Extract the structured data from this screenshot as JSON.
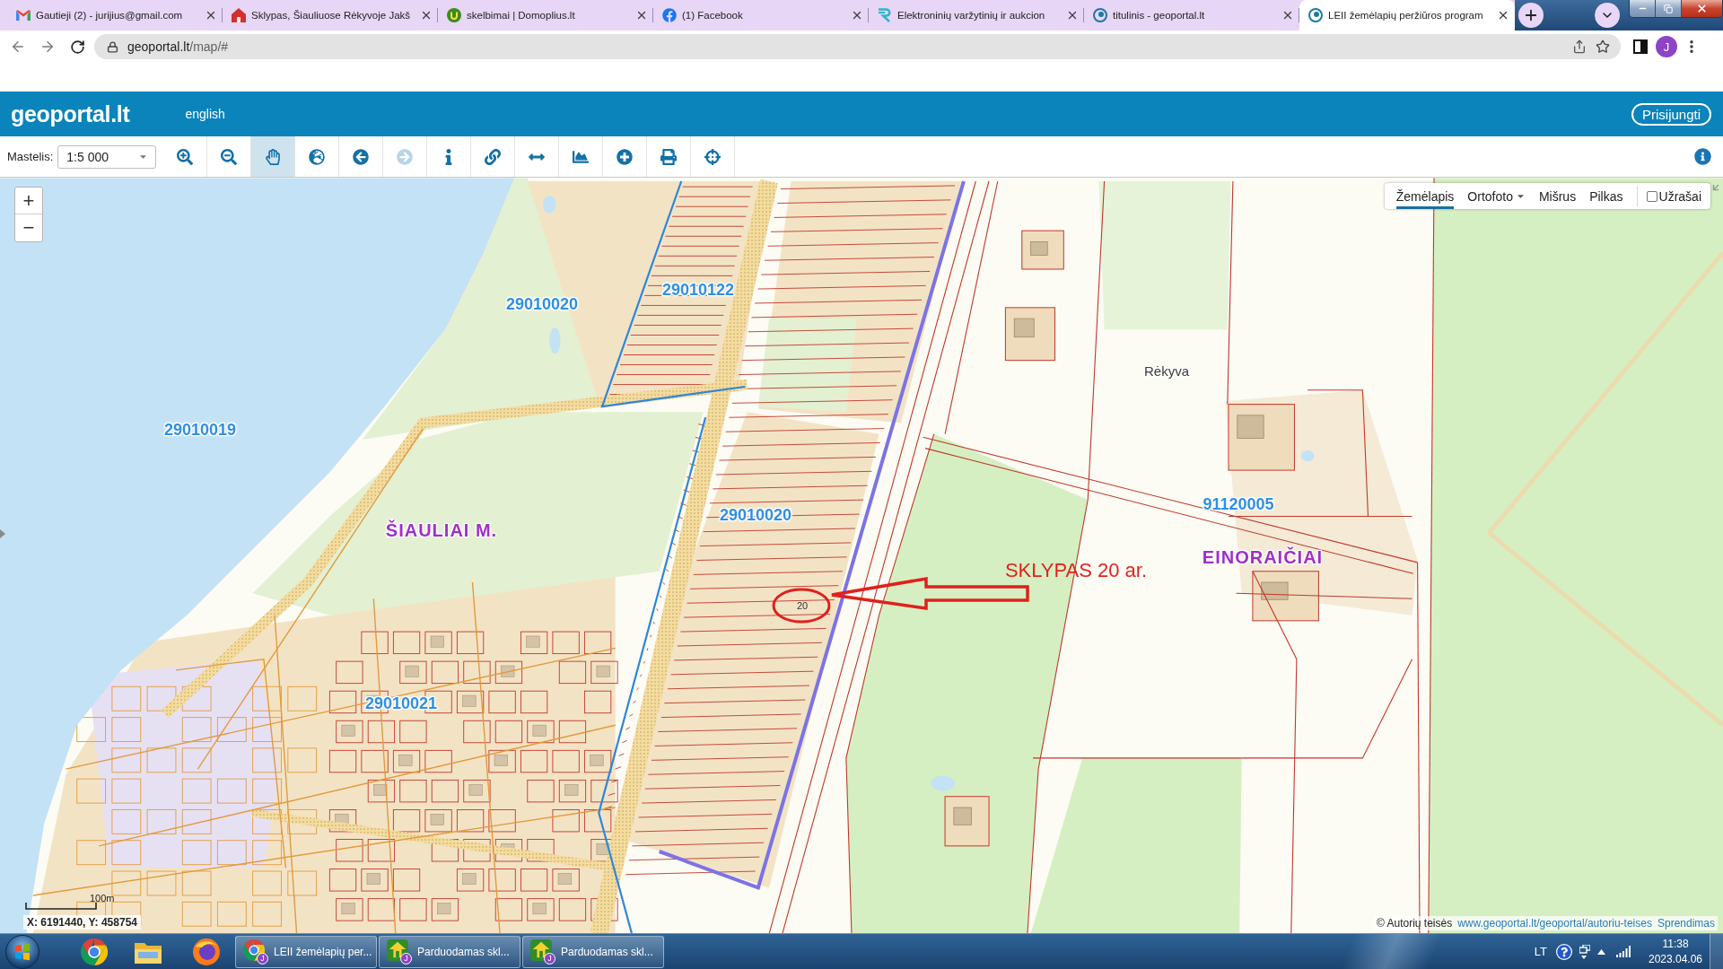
{
  "browser": {
    "tabs": [
      {
        "kind": "mail",
        "title": "Gautieji (2) - jurijius@gmail.com",
        "selected": false
      },
      {
        "kind": "house",
        "title": "Sklypas, Šiauliuose Rėkyvoje Jakš",
        "selected": false
      },
      {
        "kind": "badge",
        "title": "skelbimai | Domoplius.lt",
        "selected": false
      },
      {
        "kind": "facebook",
        "title": "(1) Facebook",
        "selected": false
      },
      {
        "kind": "swirl",
        "title": "Elektroninių varžytinių ir aukcion",
        "selected": false
      },
      {
        "kind": "eye",
        "title": "titulinis - geoportal.lt",
        "selected": false
      },
      {
        "kind": "eye",
        "title": "LEII žemėlapių peržiūros program",
        "selected": true
      }
    ],
    "address": {
      "host": "geoportal.lt",
      "path": "/map/#"
    },
    "profile_initial": "J"
  },
  "header": {
    "logo": "geoportal.lt",
    "language": "english",
    "login": "Prisijungti"
  },
  "toolbar": {
    "scale_label": "Mastelis:",
    "scale": "1:5 000",
    "tools": [
      {
        "kind": "zoom-in",
        "selected": false,
        "disabled": false
      },
      {
        "kind": "zoom-out",
        "selected": false,
        "disabled": false
      },
      {
        "kind": "pan",
        "selected": true,
        "disabled": false
      },
      {
        "kind": "globe",
        "selected": false,
        "disabled": false
      },
      {
        "kind": "back",
        "selected": false,
        "disabled": false
      },
      {
        "kind": "forward",
        "selected": false,
        "disabled": true
      },
      {
        "kind": "info",
        "selected": false,
        "disabled": false
      },
      {
        "kind": "link",
        "selected": false,
        "disabled": false
      },
      {
        "kind": "measure",
        "selected": false,
        "disabled": false
      },
      {
        "kind": "profile",
        "selected": false,
        "disabled": false
      },
      {
        "kind": "add",
        "selected": false,
        "disabled": false
      },
      {
        "kind": "print",
        "selected": false,
        "disabled": false
      },
      {
        "kind": "locate",
        "selected": false,
        "disabled": false
      }
    ]
  },
  "map": {
    "zoom": [
      "+",
      "−"
    ],
    "layers": [
      {
        "label": "Žemėlapis",
        "selected": true,
        "has_menu": false
      },
      {
        "label": "Ortofoto",
        "selected": false,
        "has_menu": true
      },
      {
        "label": "Mišrus",
        "selected": false,
        "has_menu": false
      },
      {
        "label": "Pilkas",
        "selected": false,
        "has_menu": false
      }
    ],
    "labels_toggle": {
      "label": "Užrašai",
      "checked": false
    },
    "labels": [
      {
        "kind": "cadastre",
        "text": "29010122"
      },
      {
        "kind": "cadastre",
        "text": "29010020"
      },
      {
        "kind": "village",
        "text": "Rėkyva"
      },
      {
        "kind": "cadastre",
        "text": "29010019"
      },
      {
        "kind": "cadastre",
        "text": "91120005"
      },
      {
        "kind": "cadastre",
        "text": "29010020"
      },
      {
        "kind": "place",
        "text": "ŠIAULIAI M."
      },
      {
        "kind": "place",
        "text": "EINORAIČIAI"
      },
      {
        "kind": "annotation",
        "text": "SKLYPAS 20 ar."
      },
      {
        "kind": "parcel",
        "text": "20"
      },
      {
        "kind": "cadastre",
        "text": "29010021"
      }
    ],
    "scale_bar": "100m",
    "coordinates": "X: 6191440, Y: 458754",
    "copyright": "© Autorių teisės",
    "copyright_link": "www.geoportal.lt/geoportal/autoriu-teises",
    "solutions_link": "Sprendimas"
  },
  "taskbar": {
    "tasks": [
      {
        "kind": "browser",
        "label": "LEII žemėlapių per...",
        "badge": "J"
      },
      {
        "kind": "listing",
        "label": "Parduodamas skl...",
        "badge": "J"
      },
      {
        "kind": "listing",
        "label": "Parduodamas skl...",
        "badge": "J"
      }
    ],
    "language": "LT",
    "time": "11:38",
    "date": "2023.04.06"
  }
}
